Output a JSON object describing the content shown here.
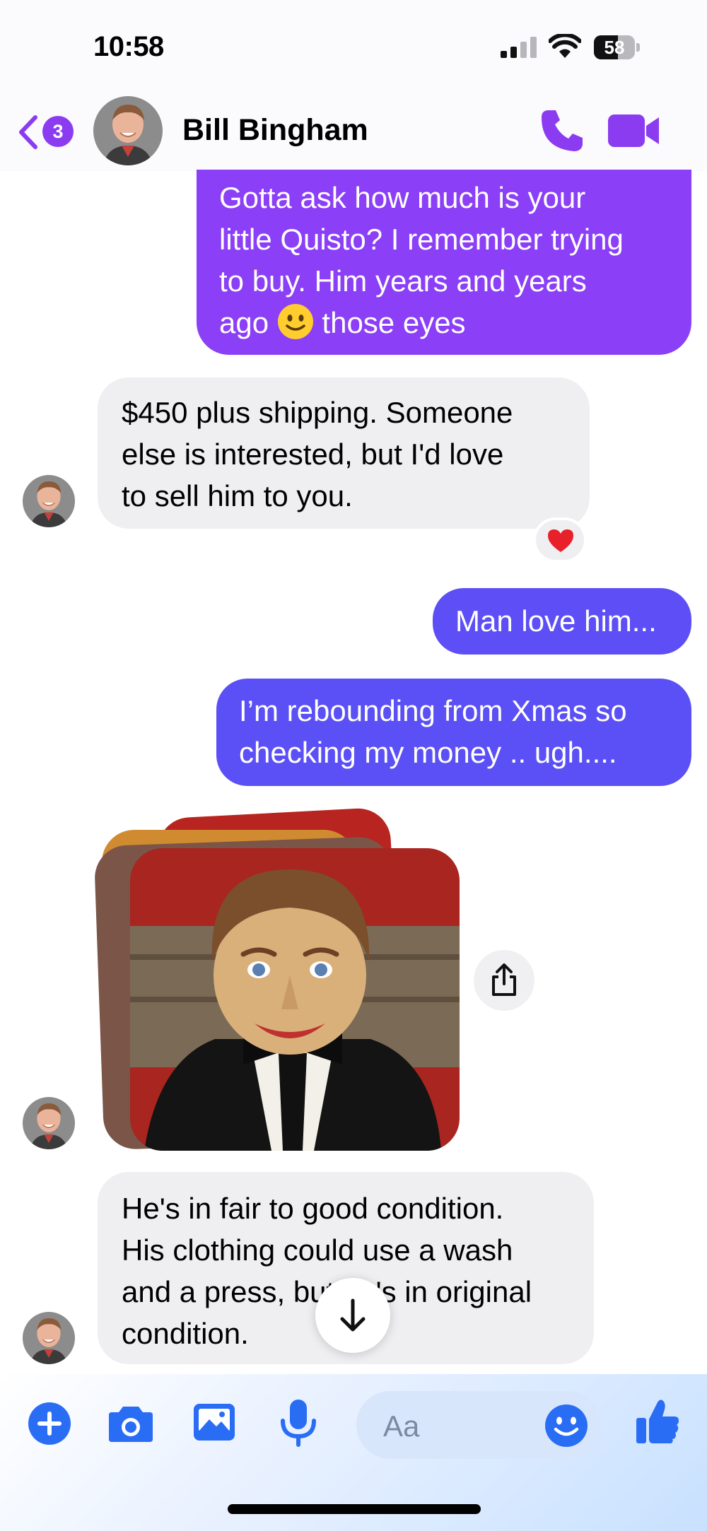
{
  "status_bar": {
    "time": "10:58",
    "battery": "58",
    "battery_level": 0.58
  },
  "header": {
    "back_badge": "3",
    "contact_name": "Bill Bingham"
  },
  "messages": [
    {
      "direction": "sent",
      "text": "Gotta ask how much is your\nlittle Quisto? I remember trying\nto buy. Him years and years\nago",
      "emoji": "slightly-smiling-face",
      "text_after_emoji": " those eyes"
    },
    {
      "direction": "received",
      "text": "$450 plus shipping.  Someone\nelse is interested, but I'd love\nto sell him to you.",
      "reaction": "red-heart"
    },
    {
      "direction": "sent",
      "text": "Man love him..."
    },
    {
      "direction": "sent",
      "text": "I’m rebounding from Xmas so\nchecking my money .. ugh...."
    },
    {
      "direction": "received",
      "type": "photo-stack"
    },
    {
      "direction": "received",
      "text": "He's in fair to good condition.\nHis clothing could use a wash\nand a press, but he's in original\ncondition."
    }
  ],
  "composer": {
    "placeholder": "Aa"
  },
  "colors": {
    "accent": "#8b3cf0",
    "sent_purple": "#8b3ff7",
    "sent_indigo": "#5b50f5",
    "received": "#efeff1",
    "composer_blue": "#2a6df5"
  },
  "icons": [
    "back-chevron-icon",
    "phone-icon",
    "video-camera-icon",
    "heart-icon",
    "share-icon",
    "arrow-down-icon",
    "plus-icon",
    "camera-icon",
    "gallery-icon",
    "microphone-icon",
    "emoji-icon",
    "thumbs-up-icon"
  ]
}
